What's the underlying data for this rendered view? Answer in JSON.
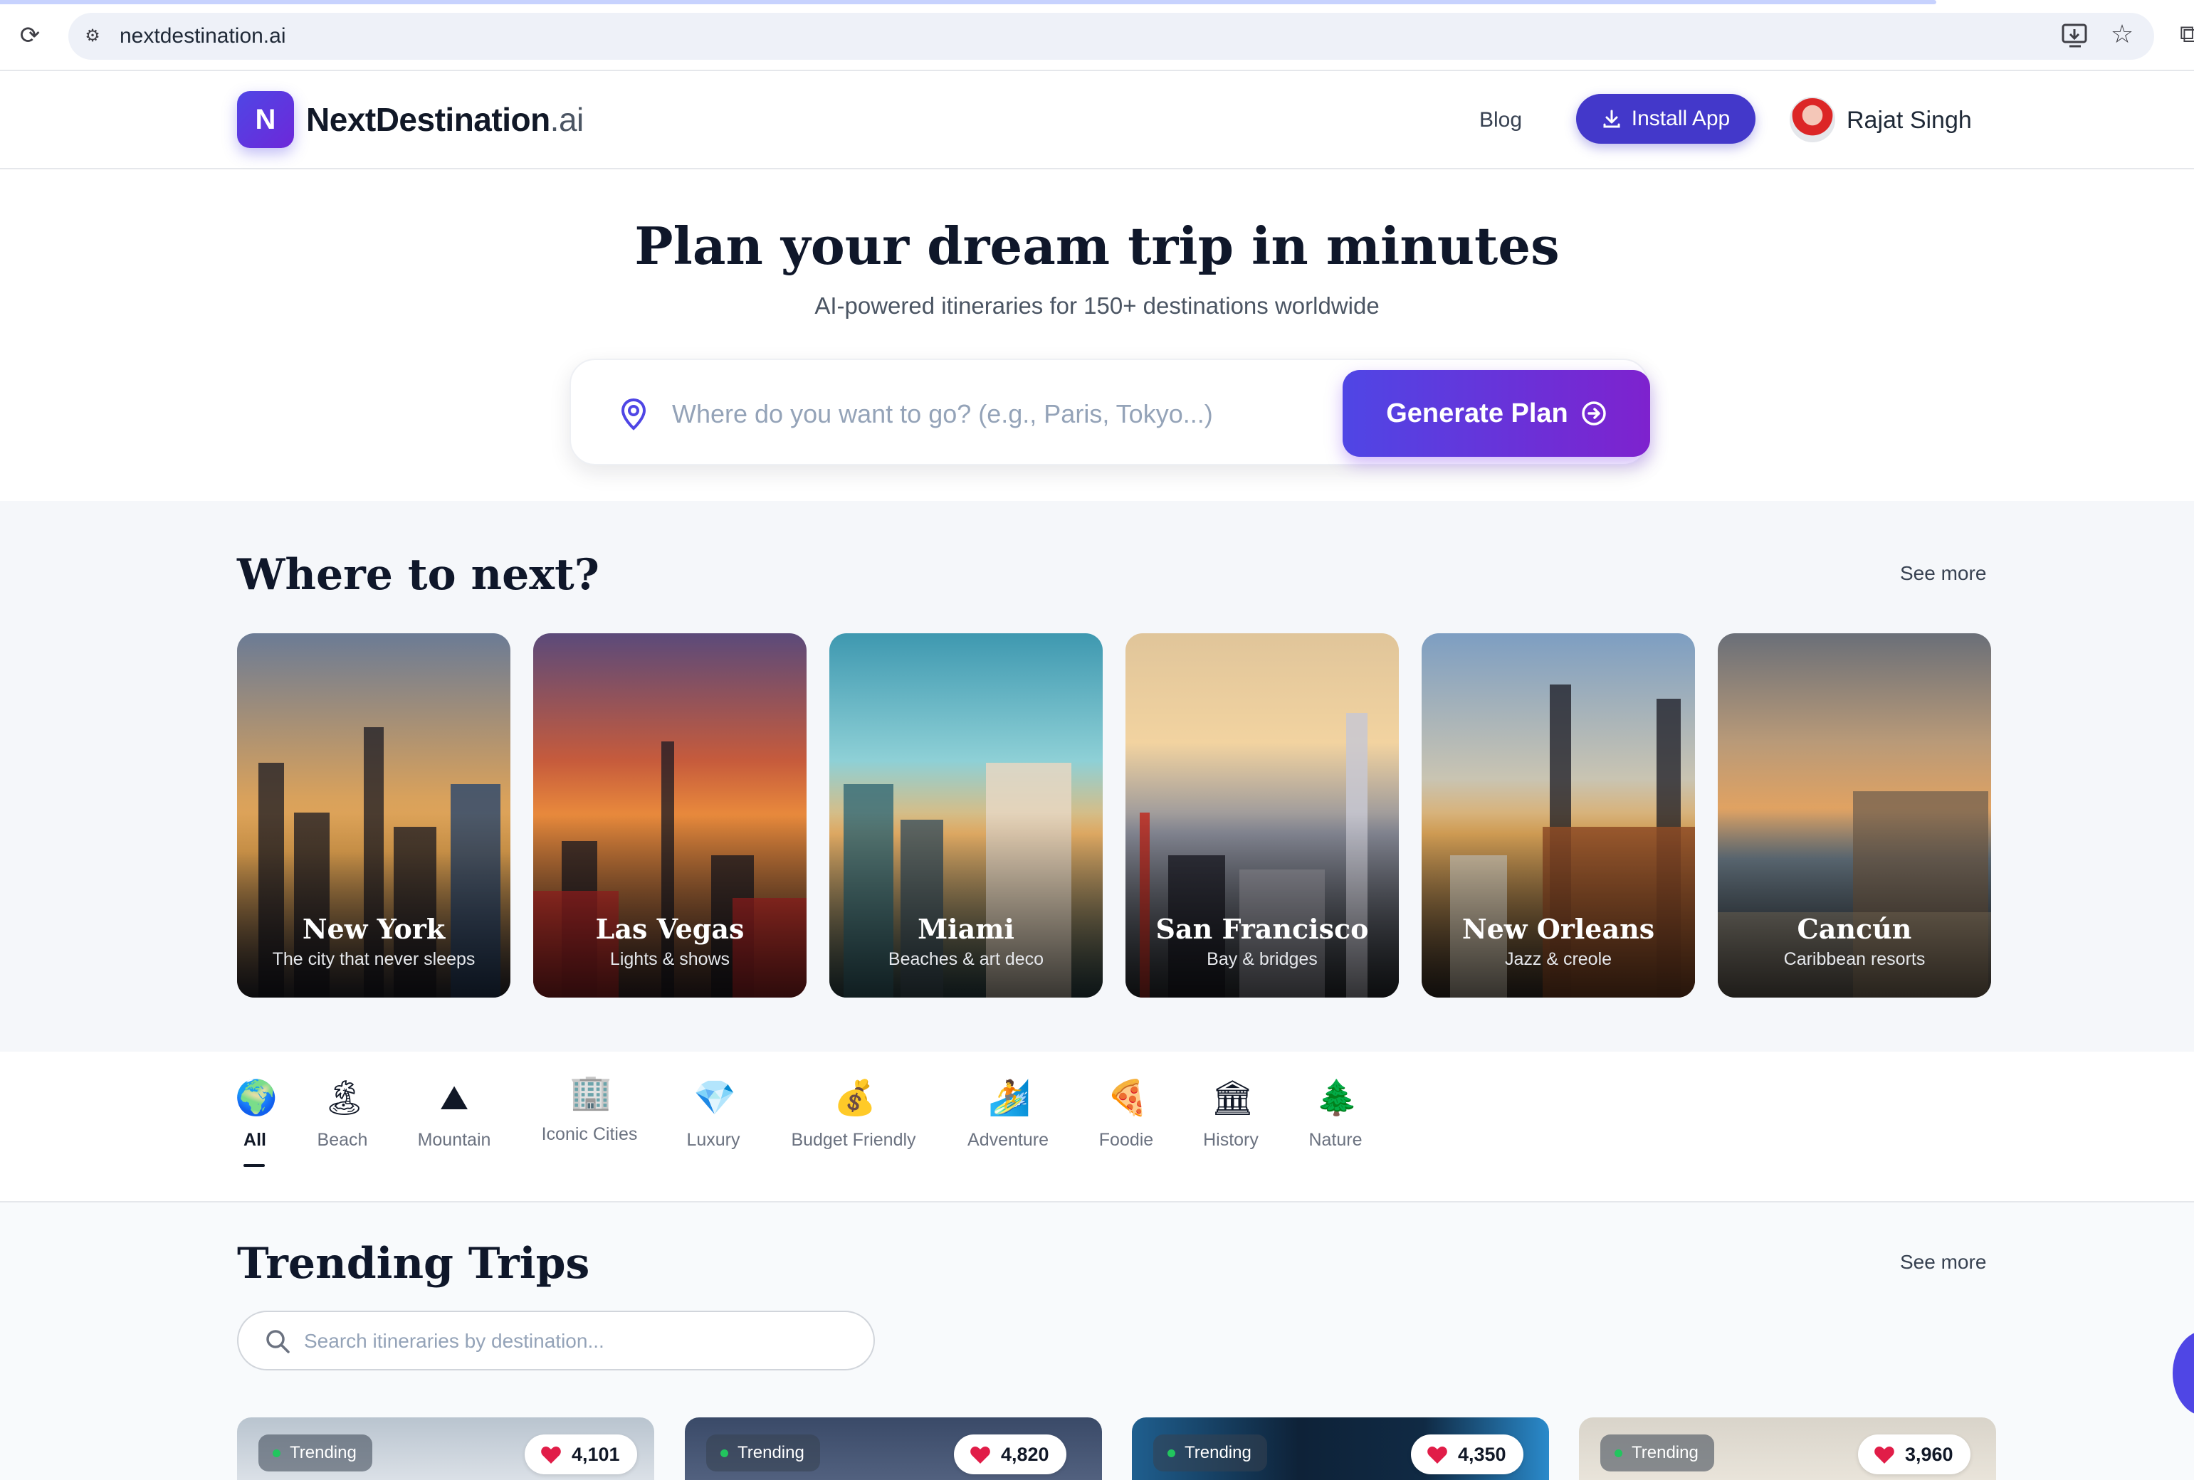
{
  "browser": {
    "url": "nextdestination.ai",
    "icons": [
      "reload-icon",
      "site-info-icon",
      "install-page-icon",
      "bookmark-icon",
      "extensions-icon"
    ]
  },
  "header": {
    "logo_letter": "N",
    "brand_name": "NextDestination",
    "brand_tld": ".ai",
    "nav_blog": "Blog",
    "install_label": "Install App",
    "user_name": "Rajat Singh"
  },
  "hero": {
    "title": "Plan your dream trip in minutes",
    "subtitle": "AI-powered itineraries for 150+ destinations worldwide",
    "search_placeholder": "Where do you want to go? (e.g., Paris, Tokyo...)",
    "generate_label": "Generate Plan"
  },
  "where_next": {
    "title": "Where to next?",
    "see_more": "See more",
    "destinations": [
      {
        "name": "New York",
        "tagline": "The city that never sleeps"
      },
      {
        "name": "Las Vegas",
        "tagline": "Lights & shows"
      },
      {
        "name": "Miami",
        "tagline": "Beaches & art deco"
      },
      {
        "name": "San Francisco",
        "tagline": "Bay & bridges"
      },
      {
        "name": "New Orleans",
        "tagline": "Jazz & creole"
      },
      {
        "name": "Cancún",
        "tagline": "Caribbean resorts"
      }
    ]
  },
  "categories": [
    {
      "label": "All",
      "icon": "🌍",
      "icon_name": "globe-icon",
      "active": true
    },
    {
      "label": "Beach",
      "icon": "🏝",
      "icon_name": "beach-icon"
    },
    {
      "label": "Mountain",
      "icon": "⛰",
      "icon_name": "mountain-icon"
    },
    {
      "label": "Iconic Cities",
      "icon": "🏢",
      "icon_name": "building-icon"
    },
    {
      "label": "Luxury",
      "icon": "💎",
      "icon_name": "diamond-icon"
    },
    {
      "label": "Budget Friendly",
      "icon": "💰",
      "icon_name": "money-bag-icon"
    },
    {
      "label": "Adventure",
      "icon": "🏄",
      "icon_name": "surfer-icon"
    },
    {
      "label": "Foodie",
      "icon": "🍕",
      "icon_name": "pizza-icon"
    },
    {
      "label": "History",
      "icon": "🏛",
      "icon_name": "classical-building-icon"
    },
    {
      "label": "Nature",
      "icon": "🌲",
      "icon_name": "tree-icon"
    }
  ],
  "trending": {
    "title": "Trending Trips",
    "see_more": "See more",
    "search_placeholder": "Search itineraries by destination...",
    "trips": [
      {
        "badge": "Trending",
        "likes": "4,101"
      },
      {
        "badge": "Trending",
        "likes": "4,820"
      },
      {
        "badge": "Trending",
        "likes": "4,350"
      },
      {
        "badge": "Trending",
        "likes": "3,960"
      }
    ]
  },
  "colors": {
    "accent": "#4f46e5",
    "accent_purple": "#7e22ce",
    "heart": "#e11d48",
    "trending_dot": "#22c55e"
  }
}
